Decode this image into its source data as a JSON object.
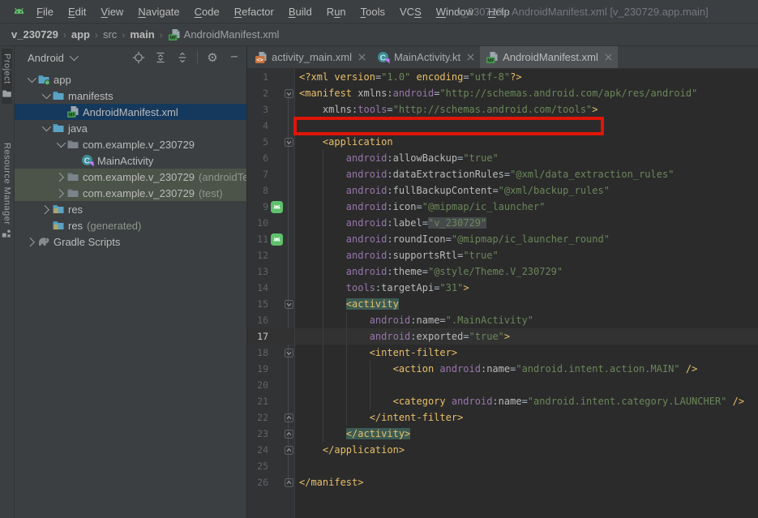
{
  "window": {
    "title": "v_230729 - AndroidManifest.xml [v_230729.app.main]"
  },
  "menu": {
    "items": [
      {
        "label": "File",
        "m": 0
      },
      {
        "label": "Edit",
        "m": 0
      },
      {
        "label": "View",
        "m": 0
      },
      {
        "label": "Navigate",
        "m": 0
      },
      {
        "label": "Code",
        "m": 0
      },
      {
        "label": "Refactor",
        "m": 0
      },
      {
        "label": "Build",
        "m": 0
      },
      {
        "label": "Run",
        "m": 1
      },
      {
        "label": "Tools",
        "m": 0
      },
      {
        "label": "VCS",
        "m": 2
      },
      {
        "label": "Window",
        "m": 0
      },
      {
        "label": "Help",
        "m": 0
      }
    ]
  },
  "breadcrumb": {
    "separator": "›",
    "items": [
      {
        "label": "v_230729",
        "bold": true,
        "icon": ""
      },
      {
        "label": "app",
        "bold": true,
        "icon": ""
      },
      {
        "label": "src",
        "bold": false,
        "icon": ""
      },
      {
        "label": "main",
        "bold": true,
        "icon": ""
      },
      {
        "label": "AndroidManifest.xml",
        "bold": false,
        "icon": "manifest-file-icon"
      }
    ]
  },
  "stripe": {
    "items": [
      {
        "label": "Project",
        "icon": "stripe-folder-icon",
        "active": true
      },
      {
        "label": "Resource Manager",
        "icon": "resource-manager-icon",
        "active": false
      }
    ]
  },
  "project": {
    "selector_label": "Android",
    "toolbar": [
      "locate-icon",
      "expand-all-icon",
      "collapse-all-icon",
      "separator",
      "gear-icon",
      "hide-icon"
    ],
    "tree": [
      {
        "label": "app",
        "suffix": "",
        "level": 0,
        "chevron": "down",
        "icon": "app-folder-icon",
        "state": ""
      },
      {
        "label": "manifests",
        "suffix": "",
        "level": 1,
        "chevron": "down",
        "icon": "folder-icon",
        "state": ""
      },
      {
        "label": "AndroidManifest.xml",
        "suffix": "",
        "level": 2,
        "chevron": "none",
        "icon": "manifest-file-icon",
        "state": "selected"
      },
      {
        "label": "java",
        "suffix": "",
        "level": 1,
        "chevron": "down",
        "icon": "folder-icon",
        "state": ""
      },
      {
        "label": "com.example.v_230729",
        "suffix": "",
        "level": 2,
        "chevron": "down",
        "icon": "package-icon",
        "state": ""
      },
      {
        "label": "MainActivity",
        "suffix": "",
        "level": 3,
        "chevron": "none",
        "icon": "kotlin-class-icon",
        "state": ""
      },
      {
        "label": "com.example.v_230729",
        "suffix": "(androidTest)",
        "level": 2,
        "chevron": "right",
        "icon": "package-icon",
        "state": "highlight"
      },
      {
        "label": "com.example.v_230729",
        "suffix": "(test)",
        "level": 2,
        "chevron": "right",
        "icon": "package-icon",
        "state": "highlight"
      },
      {
        "label": "res",
        "suffix": "",
        "level": 1,
        "chevron": "right",
        "icon": "res-folder-icon",
        "state": ""
      },
      {
        "label": "res",
        "suffix": "(generated)",
        "level": 1,
        "chevron": "none",
        "icon": "res-folder-icon",
        "state": ""
      },
      {
        "label": "Gradle Scripts",
        "suffix": "",
        "level": 0,
        "chevron": "right",
        "icon": "gradle-icon",
        "state": ""
      }
    ]
  },
  "editor": {
    "tabs": [
      {
        "label": "activity_main.xml",
        "icon": "xml-file-icon",
        "active": false
      },
      {
        "label": "MainActivity.kt",
        "icon": "kotlin-class-icon",
        "active": false
      },
      {
        "label": "AndroidManifest.xml",
        "icon": "manifest-file-icon",
        "active": true
      }
    ],
    "lines": [
      {
        "n": 1,
        "fold": "",
        "gutter_icon": "",
        "current": false,
        "seg": [
          [
            "tag",
            "<?xml "
          ],
          [
            "tag",
            "version"
          ],
          [
            "g",
            "="
          ],
          [
            "str",
            "\"1.0\""
          ],
          [
            "g",
            " "
          ],
          [
            "tag",
            "encoding"
          ],
          [
            "g",
            "="
          ],
          [
            "str",
            "\"utf-8\""
          ],
          [
            "tag",
            "?>"
          ]
        ]
      },
      {
        "n": 2,
        "fold": "start",
        "gutter_icon": "",
        "current": false,
        "seg": [
          [
            "tag",
            "<manifest "
          ],
          [
            "attr",
            "xmlns"
          ],
          [
            "g",
            ":"
          ],
          [
            "ns",
            "android"
          ],
          [
            "g",
            "="
          ],
          [
            "str",
            "\"http://schemas.android.com/apk/res/android\""
          ]
        ]
      },
      {
        "n": 3,
        "fold": "",
        "gutter_icon": "",
        "current": false,
        "seg": [
          [
            "g",
            "    "
          ],
          [
            "attr",
            "xmlns"
          ],
          [
            "g",
            ":"
          ],
          [
            "ns",
            "tools"
          ],
          [
            "g",
            "="
          ],
          [
            "str",
            "\"http://schemas.android.com/tools\""
          ],
          [
            "tag",
            ">"
          ]
        ]
      },
      {
        "n": 4,
        "fold": "",
        "gutter_icon": "",
        "current": false,
        "seg": []
      },
      {
        "n": 5,
        "fold": "start",
        "gutter_icon": "",
        "current": false,
        "seg": [
          [
            "g",
            "    "
          ],
          [
            "tag",
            "<application"
          ]
        ]
      },
      {
        "n": 6,
        "fold": "",
        "gutter_icon": "",
        "current": false,
        "seg": [
          [
            "g",
            "        "
          ],
          [
            "ns",
            "android"
          ],
          [
            "g",
            ":"
          ],
          [
            "attr",
            "allowBackup"
          ],
          [
            "g",
            "="
          ],
          [
            "str",
            "\"true\""
          ]
        ]
      },
      {
        "n": 7,
        "fold": "",
        "gutter_icon": "",
        "current": false,
        "seg": [
          [
            "g",
            "        "
          ],
          [
            "ns",
            "android"
          ],
          [
            "g",
            ":"
          ],
          [
            "attr",
            "dataExtractionRules"
          ],
          [
            "g",
            "="
          ],
          [
            "str",
            "\"@xml/data_extraction_rules\""
          ]
        ]
      },
      {
        "n": 8,
        "fold": "",
        "gutter_icon": "",
        "current": false,
        "seg": [
          [
            "g",
            "        "
          ],
          [
            "ns",
            "android"
          ],
          [
            "g",
            ":"
          ],
          [
            "attr",
            "fullBackupContent"
          ],
          [
            "g",
            "="
          ],
          [
            "str",
            "\"@xml/backup_rules\""
          ]
        ]
      },
      {
        "n": 9,
        "fold": "",
        "gutter_icon": "android-launcher-icon",
        "current": false,
        "seg": [
          [
            "g",
            "        "
          ],
          [
            "ns",
            "android"
          ],
          [
            "g",
            ":"
          ],
          [
            "attr",
            "icon"
          ],
          [
            "g",
            "="
          ],
          [
            "str",
            "\"@mipmap/ic_launcher\""
          ]
        ]
      },
      {
        "n": 10,
        "fold": "",
        "gutter_icon": "",
        "current": false,
        "seg": [
          [
            "g",
            "        "
          ],
          [
            "ns",
            "android"
          ],
          [
            "g",
            ":"
          ],
          [
            "attr",
            "label"
          ],
          [
            "g",
            "="
          ],
          [
            "strhl",
            "\"v_230729\""
          ]
        ]
      },
      {
        "n": 11,
        "fold": "",
        "gutter_icon": "android-launcher-icon",
        "current": false,
        "seg": [
          [
            "g",
            "        "
          ],
          [
            "ns",
            "android"
          ],
          [
            "g",
            ":"
          ],
          [
            "attr",
            "roundIcon"
          ],
          [
            "g",
            "="
          ],
          [
            "str",
            "\"@mipmap/ic_launcher_round\""
          ]
        ]
      },
      {
        "n": 12,
        "fold": "",
        "gutter_icon": "",
        "current": false,
        "seg": [
          [
            "g",
            "        "
          ],
          [
            "ns",
            "android"
          ],
          [
            "g",
            ":"
          ],
          [
            "attr",
            "supportsRtl"
          ],
          [
            "g",
            "="
          ],
          [
            "str",
            "\"true\""
          ]
        ]
      },
      {
        "n": 13,
        "fold": "",
        "gutter_icon": "",
        "current": false,
        "seg": [
          [
            "g",
            "        "
          ],
          [
            "ns",
            "android"
          ],
          [
            "g",
            ":"
          ],
          [
            "attr",
            "theme"
          ],
          [
            "g",
            "="
          ],
          [
            "str",
            "\"@style/Theme.V_230729\""
          ]
        ]
      },
      {
        "n": 14,
        "fold": "",
        "gutter_icon": "",
        "current": false,
        "seg": [
          [
            "g",
            "        "
          ],
          [
            "ns",
            "tools"
          ],
          [
            "g",
            ":"
          ],
          [
            "attr",
            "targetApi"
          ],
          [
            "g",
            "="
          ],
          [
            "str",
            "\"31\""
          ],
          [
            "tag",
            ">"
          ]
        ]
      },
      {
        "n": 15,
        "fold": "start",
        "gutter_icon": "",
        "current": false,
        "seg": [
          [
            "g",
            "        "
          ],
          [
            "taghl",
            "<activity"
          ]
        ]
      },
      {
        "n": 16,
        "fold": "",
        "gutter_icon": "",
        "current": false,
        "seg": [
          [
            "g",
            "            "
          ],
          [
            "ns",
            "android"
          ],
          [
            "g",
            ":"
          ],
          [
            "attr",
            "name"
          ],
          [
            "g",
            "="
          ],
          [
            "str",
            "\".MainActivity\""
          ]
        ]
      },
      {
        "n": 17,
        "fold": "",
        "gutter_icon": "",
        "current": true,
        "seg": [
          [
            "g",
            "            "
          ],
          [
            "ns",
            "android"
          ],
          [
            "g",
            ":"
          ],
          [
            "attr",
            "exported"
          ],
          [
            "g",
            "="
          ],
          [
            "str",
            "\"true\""
          ],
          [
            "tag",
            ">"
          ]
        ]
      },
      {
        "n": 18,
        "fold": "start",
        "gutter_icon": "",
        "current": false,
        "seg": [
          [
            "g",
            "            "
          ],
          [
            "tag",
            "<intent-filter>"
          ]
        ]
      },
      {
        "n": 19,
        "fold": "",
        "gutter_icon": "",
        "current": false,
        "seg": [
          [
            "g",
            "                "
          ],
          [
            "tag",
            "<action "
          ],
          [
            "ns",
            "android"
          ],
          [
            "g",
            ":"
          ],
          [
            "attr",
            "name"
          ],
          [
            "g",
            "="
          ],
          [
            "str",
            "\"android.intent.action.MAIN\""
          ],
          [
            "g",
            " "
          ],
          [
            "tag",
            "/>"
          ]
        ]
      },
      {
        "n": 20,
        "fold": "",
        "gutter_icon": "",
        "current": false,
        "seg": []
      },
      {
        "n": 21,
        "fold": "",
        "gutter_icon": "",
        "current": false,
        "seg": [
          [
            "g",
            "                "
          ],
          [
            "tag",
            "<category "
          ],
          [
            "ns",
            "android"
          ],
          [
            "g",
            ":"
          ],
          [
            "attr",
            "name"
          ],
          [
            "g",
            "="
          ],
          [
            "str",
            "\"android.intent.category.LAUNCHER\""
          ],
          [
            "g",
            " "
          ],
          [
            "tag",
            "/>"
          ]
        ]
      },
      {
        "n": 22,
        "fold": "end",
        "gutter_icon": "",
        "current": false,
        "seg": [
          [
            "g",
            "            "
          ],
          [
            "tag",
            "</intent-filter>"
          ]
        ]
      },
      {
        "n": 23,
        "fold": "end",
        "gutter_icon": "",
        "current": false,
        "seg": [
          [
            "g",
            "        "
          ],
          [
            "taghl",
            "</activity>"
          ]
        ]
      },
      {
        "n": 24,
        "fold": "end",
        "gutter_icon": "",
        "current": false,
        "seg": [
          [
            "g",
            "    "
          ],
          [
            "tag",
            "</application>"
          ]
        ]
      },
      {
        "n": 25,
        "fold": "",
        "gutter_icon": "",
        "current": false,
        "seg": []
      },
      {
        "n": 26,
        "fold": "end",
        "gutter_icon": "",
        "current": false,
        "seg": [
          [
            "tag",
            "</manifest>"
          ]
        ]
      }
    ]
  },
  "annotation": {
    "type": "highlight-rectangle",
    "line": 4,
    "color": "#DF1508"
  },
  "colors": {
    "editor_bg": "#2B2B2B",
    "panel_bg": "#3C3F41",
    "tree_selection": "#15395C",
    "tree_highlight": "#4C5349",
    "xml_tag": "#E8BF6A",
    "xml_attr": "#BABABA",
    "xml_namespace": "#9876AA",
    "xml_string": "#6A8759",
    "tag_match_bg": "#3C5B53",
    "current_line_bg": "#323232",
    "line_number": "#606366",
    "annotation_red": "#DF1508"
  }
}
